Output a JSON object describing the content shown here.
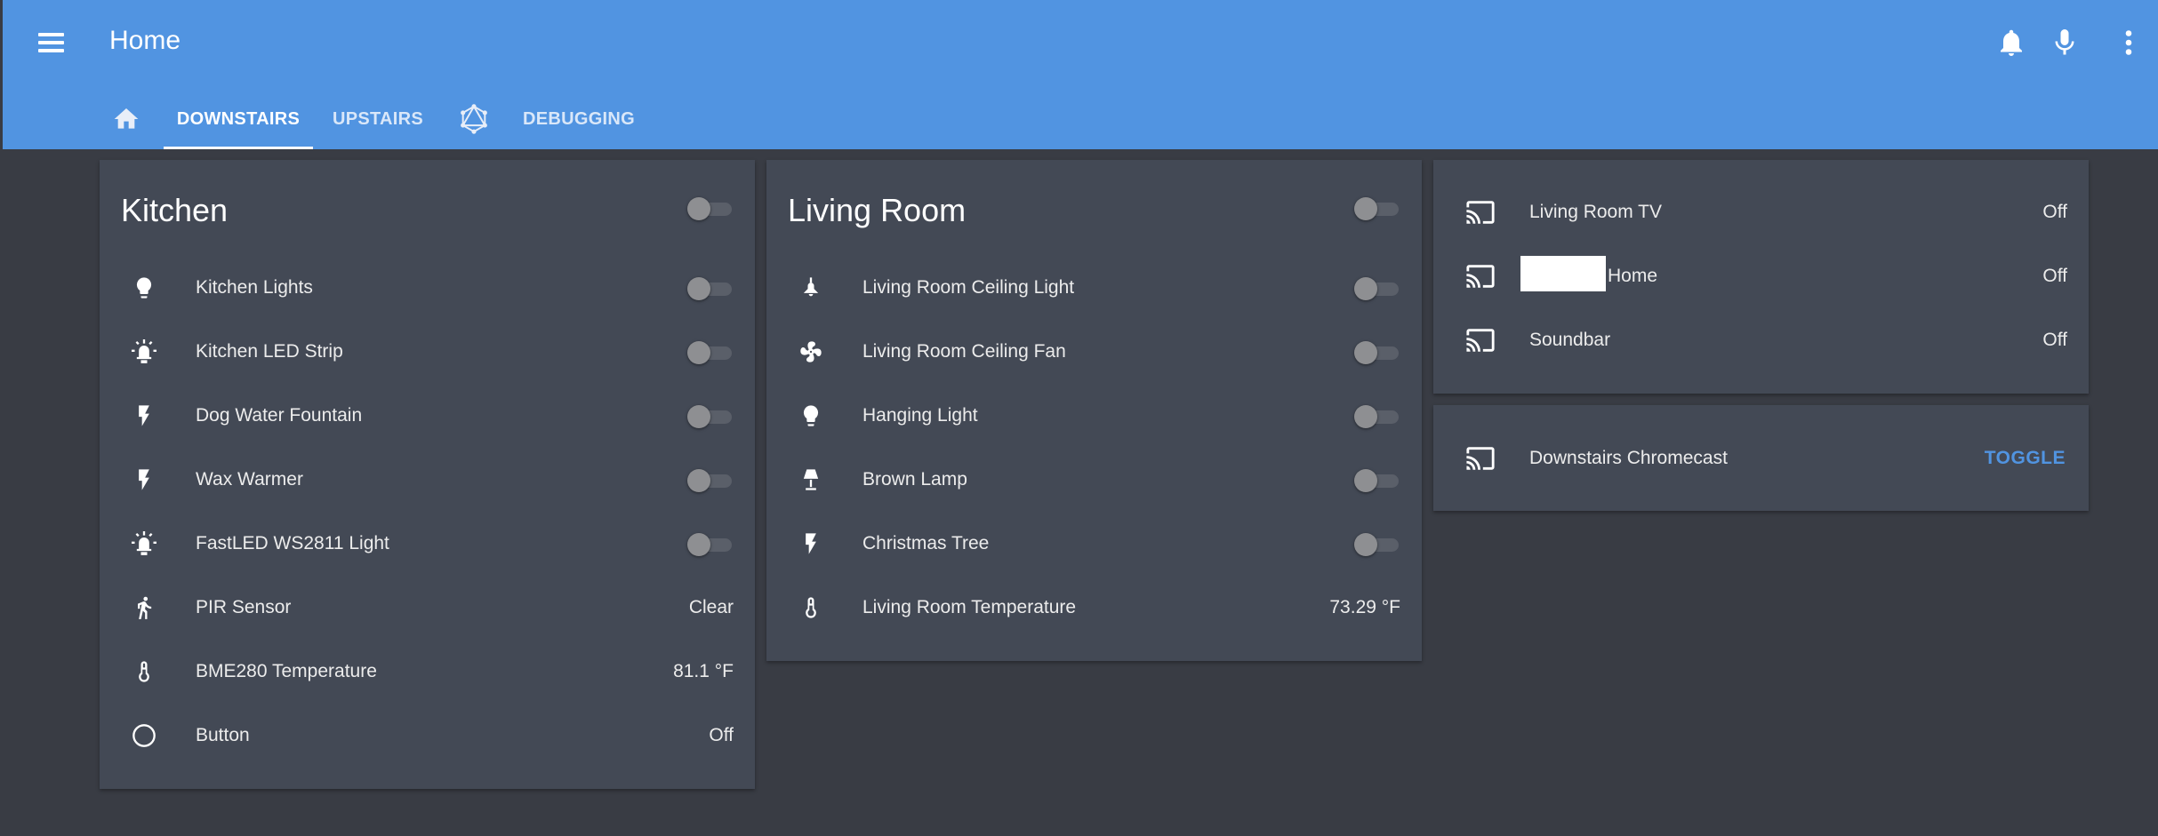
{
  "header": {
    "title": "Home",
    "icons": [
      "menu-icon",
      "bell-icon",
      "microphone-icon",
      "more-vert-icon"
    ],
    "color": "#5194e1"
  },
  "tabs": [
    {
      "icon": "home-icon",
      "label": ""
    },
    {
      "label": "DOWNSTAIRS",
      "active": true
    },
    {
      "label": "UPSTAIRS"
    },
    {
      "icon": "graph-icon",
      "label": ""
    },
    {
      "label": "DEBUGGING"
    }
  ],
  "kitchen": {
    "title": "Kitchen",
    "rows": [
      {
        "icon": "lightbulb-icon",
        "name": "Kitchen Lights",
        "toggle": "off"
      },
      {
        "icon": "led-strip-icon",
        "name": "Kitchen LED Strip",
        "toggle": "off"
      },
      {
        "icon": "flash-icon",
        "name": "Dog Water Fountain",
        "toggle": "off"
      },
      {
        "icon": "flash-icon",
        "name": "Wax Warmer",
        "toggle": "off"
      },
      {
        "icon": "led-strip-icon",
        "name": "FastLED WS2811 Light",
        "toggle": "off"
      },
      {
        "icon": "walk-icon",
        "name": "PIR Sensor",
        "state": "Clear"
      },
      {
        "icon": "thermometer-icon",
        "name": "BME280 Temperature",
        "state": "81.1 °F"
      },
      {
        "icon": "circle-icon",
        "name": "Button",
        "state": "Off"
      }
    ]
  },
  "living_room": {
    "title": "Living Room",
    "rows": [
      {
        "icon": "ceiling-light-icon",
        "name": "Living Room Ceiling Light",
        "toggle": "off"
      },
      {
        "icon": "fan-icon",
        "name": "Living Room Ceiling Fan",
        "toggle": "off"
      },
      {
        "icon": "lightbulb-icon",
        "name": "Hanging Light",
        "toggle": "off"
      },
      {
        "icon": "lamp-icon",
        "name": "Brown Lamp",
        "toggle": "off"
      },
      {
        "icon": "flash-icon",
        "name": "Christmas Tree",
        "toggle": "off"
      },
      {
        "icon": "thermometer-icon",
        "name": "Living Room Temperature",
        "state": "73.29 °F"
      }
    ]
  },
  "media": {
    "rows": [
      {
        "icon": "cast-icon",
        "name": "Living Room TV",
        "state": "Off"
      },
      {
        "icon": "cast-icon",
        "name": "Home",
        "state": "Off"
      },
      {
        "icon": "cast-icon",
        "name": "Soundbar",
        "state": "Off"
      }
    ]
  },
  "chromecast": {
    "icon": "cast-icon",
    "name": "Downstairs Chromecast",
    "action": "TOGGLE"
  }
}
